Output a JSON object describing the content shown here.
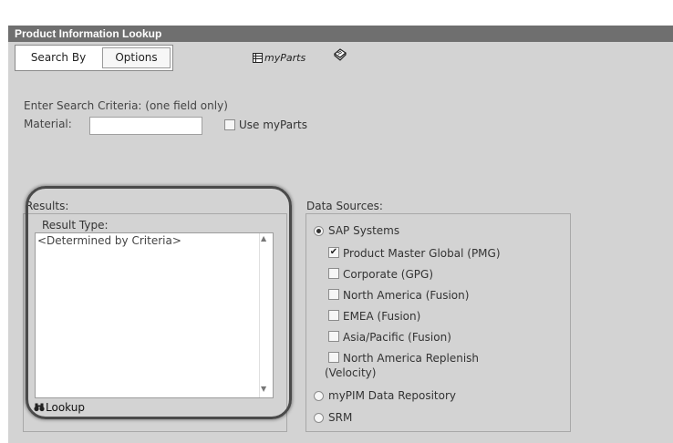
{
  "window": {
    "title": "Product Information Lookup"
  },
  "tabs": [
    {
      "label": "Search By"
    },
    {
      "label": "Options"
    }
  ],
  "toolbar": {
    "myparts_prefix": "my",
    "myparts_suffix": "Parts"
  },
  "criteria": {
    "heading": "Enter Search Criteria: (one field only)",
    "material_label": "Material:",
    "material_value": "",
    "use_myparts_label": "Use myParts",
    "use_myparts_checked": false
  },
  "results": {
    "label": "Results:",
    "result_type_label": "Result Type:",
    "list_items": [
      "<Determined by Criteria>"
    ],
    "lookup_label": "Lookup"
  },
  "data_sources": {
    "label": "Data Sources:",
    "sap": {
      "label": "SAP Systems",
      "selected": true
    },
    "systems": [
      {
        "label": "Product Master Global (PMG)",
        "checked": true
      },
      {
        "label": "Corporate (GPG)",
        "checked": false
      },
      {
        "label": "North America (Fusion)",
        "checked": false
      },
      {
        "label": "EMEA (Fusion)",
        "checked": false
      },
      {
        "label": "Asia/Pacific (Fusion)",
        "checked": false
      },
      {
        "label_line1": "North America Replenish",
        "label_line2": "(Velocity)",
        "checked": false
      }
    ],
    "mypim": {
      "label": "myPIM Data Repository",
      "selected": false
    },
    "srm": {
      "label": "SRM",
      "selected": false
    }
  },
  "icons": {
    "myparts": "grid-list-icon",
    "book": "book-icon",
    "lookup": "binoculars-icon"
  },
  "colors": {
    "title_bar": "#6f6f6f",
    "panel": "#d3d3d3"
  }
}
